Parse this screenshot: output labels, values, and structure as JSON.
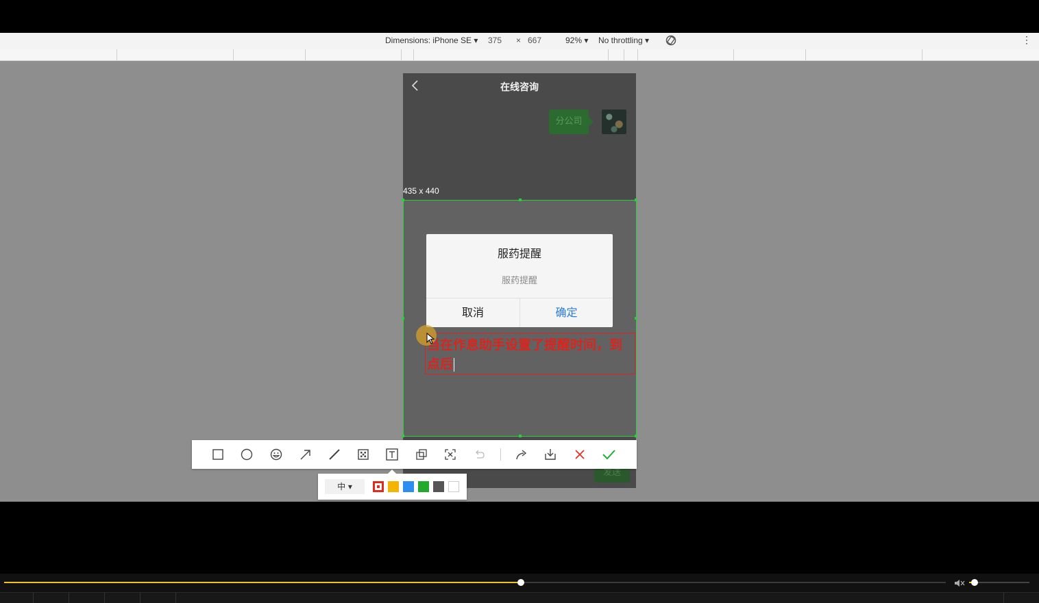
{
  "devtools": {
    "dimensions_label": "Dimensions: iPhone SE",
    "width": "375",
    "times": "×",
    "height": "667",
    "zoom": "92%",
    "throttling": "No throttling"
  },
  "phone": {
    "title": "在线咨询",
    "bubble_text": "分公司",
    "send_label": "发送"
  },
  "selection": {
    "size_label": "435 x 440"
  },
  "dialog": {
    "title": "服药提醒",
    "message": "服药提醒",
    "cancel_label": "取消",
    "ok_label": "确定"
  },
  "annotation": {
    "text": "当在作息助手设置了提醒时间，到点后"
  },
  "annotation_toolbar": {
    "tools": [
      "rectangle-icon",
      "ellipse-icon",
      "emoji-icon",
      "arrow-icon",
      "pen-icon",
      "mosaic-icon",
      "text-icon",
      "copy-icon",
      "ocr-icon",
      "undo-icon",
      "share-icon",
      "download-icon",
      "cancel-icon",
      "confirm-icon"
    ]
  },
  "color_bar": {
    "size_label": "中",
    "colors": [
      "#e32b1c",
      "#f5b400",
      "#2b8ef0",
      "#22aa2a",
      "#555555",
      "#ffffff"
    ],
    "selected_color": "#e32b1c"
  },
  "player": {
    "progress": 0.549,
    "volume": 0.09
  }
}
